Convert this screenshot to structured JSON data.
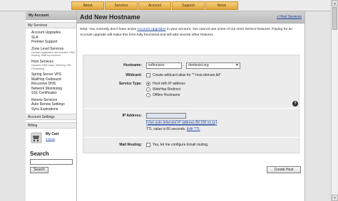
{
  "nav": {
    "items": [
      "About",
      "Services",
      "Account",
      "Support",
      "News"
    ]
  },
  "sidebar": {
    "header": "My Account",
    "services_section": "My Services",
    "links": [
      "Account Upgrades",
      "SLA",
      "Premier Support",
      "Zone Level Services",
      "Host Services",
      "Spring Server VPS",
      "MailHop Outbound",
      "Recursive DNS",
      "Network Monitoring",
      "SSL Certificates",
      "Renew Services",
      "Auto Renew Settings",
      "Sync Expirations"
    ],
    "zone_desc": "Domain registration and transfer, DNS hosting, MailHop services",
    "host_desc": "Dynamic DNS hosts, WebHop URL Forwarding",
    "account_settings": "Account Settings",
    "billing": "Billing",
    "cart_title": "My Cart",
    "cart_link": "0 items",
    "search_title": "Search",
    "search_button": "Search"
  },
  "main": {
    "title": "Add New Hostname",
    "host_services_link": "« Host Services",
    "notice_prefix": "Note: You currently don't have active ",
    "notice_link": "Account Upgrades",
    "notice_suffix": " in your account. You cannot use some of our Host Service features. Paying for an Account upgrade will make this form fully functional and will add several other features."
  },
  "form": {
    "hostname_label": "Hostname:",
    "hostname_value": "softonices",
    "domain_value": "dontexist.org",
    "wildcard_label": "Wildcard:",
    "wildcard_text": "Create wildcard alias for \"*.host.domain.tld\"",
    "service_type_label": "Service Type:",
    "service_options": [
      "Host with IP address",
      "WebHop Redirect",
      "Offline Hostname"
    ],
    "help_icon": "?",
    "ip_label": "IP Address:",
    "ip_value": "",
    "auto_ip_link": "Use auto detected IP address 89.190.xx.xx",
    "ttl_text": "TTL value is 60 seconds. ",
    "ttl_link": "Edit TTL",
    "mail_label": "Mail Routing:",
    "mail_text": "Yes, let me configure Email routing.",
    "submit_label": "Create Host"
  }
}
